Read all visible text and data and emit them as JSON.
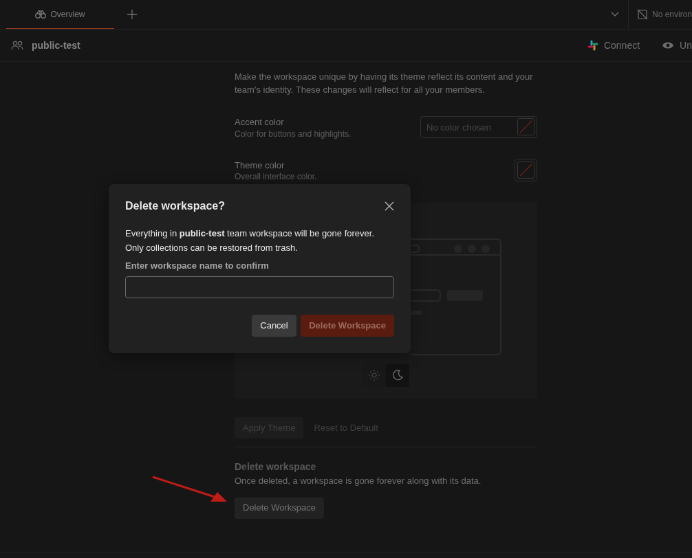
{
  "tabs": [
    {
      "label": "Overview",
      "selected": true
    }
  ],
  "environment": {
    "label": "No environ"
  },
  "workspace": {
    "name": "public-test"
  },
  "header_actions": [
    {
      "label": "Connect",
      "kind": "slack"
    },
    {
      "label": "Un",
      "kind": "eye"
    }
  ],
  "theme": {
    "description": "Make the workspace unique by having its theme reflect its content and your team's identity. These changes will reflect for all your members.",
    "settings": [
      {
        "label": "Accent color",
        "hint": "Color for buttons and highlights.",
        "placeholder": "No color chosen"
      },
      {
        "label": "Theme color",
        "hint": "Overall interface color."
      }
    ],
    "modes": [
      {
        "kind": "light",
        "selected": false
      },
      {
        "kind": "dark",
        "selected": true
      }
    ],
    "buttons": [
      {
        "label": "Apply Theme",
        "kind": "filled",
        "disabled": true
      },
      {
        "label": "Reset to Default",
        "kind": "plain",
        "disabled": true
      }
    ]
  },
  "delete_section": {
    "title": "Delete workspace",
    "text": "Once deleted, a workspace is gone forever along with its data.",
    "button": "Delete Workspace"
  },
  "dialog": {
    "title": "Delete workspace?",
    "message": "Everything in **public-test** team workspace will be gone forever. Only collections can be restored from trash.",
    "field_label": "Enter workspace name to confirm",
    "buttons": [
      {
        "label": "Cancel",
        "kind": "secondary",
        "disabled": false
      },
      {
        "label": "Delete Workspace",
        "kind": "danger",
        "disabled": true
      }
    ]
  }
}
